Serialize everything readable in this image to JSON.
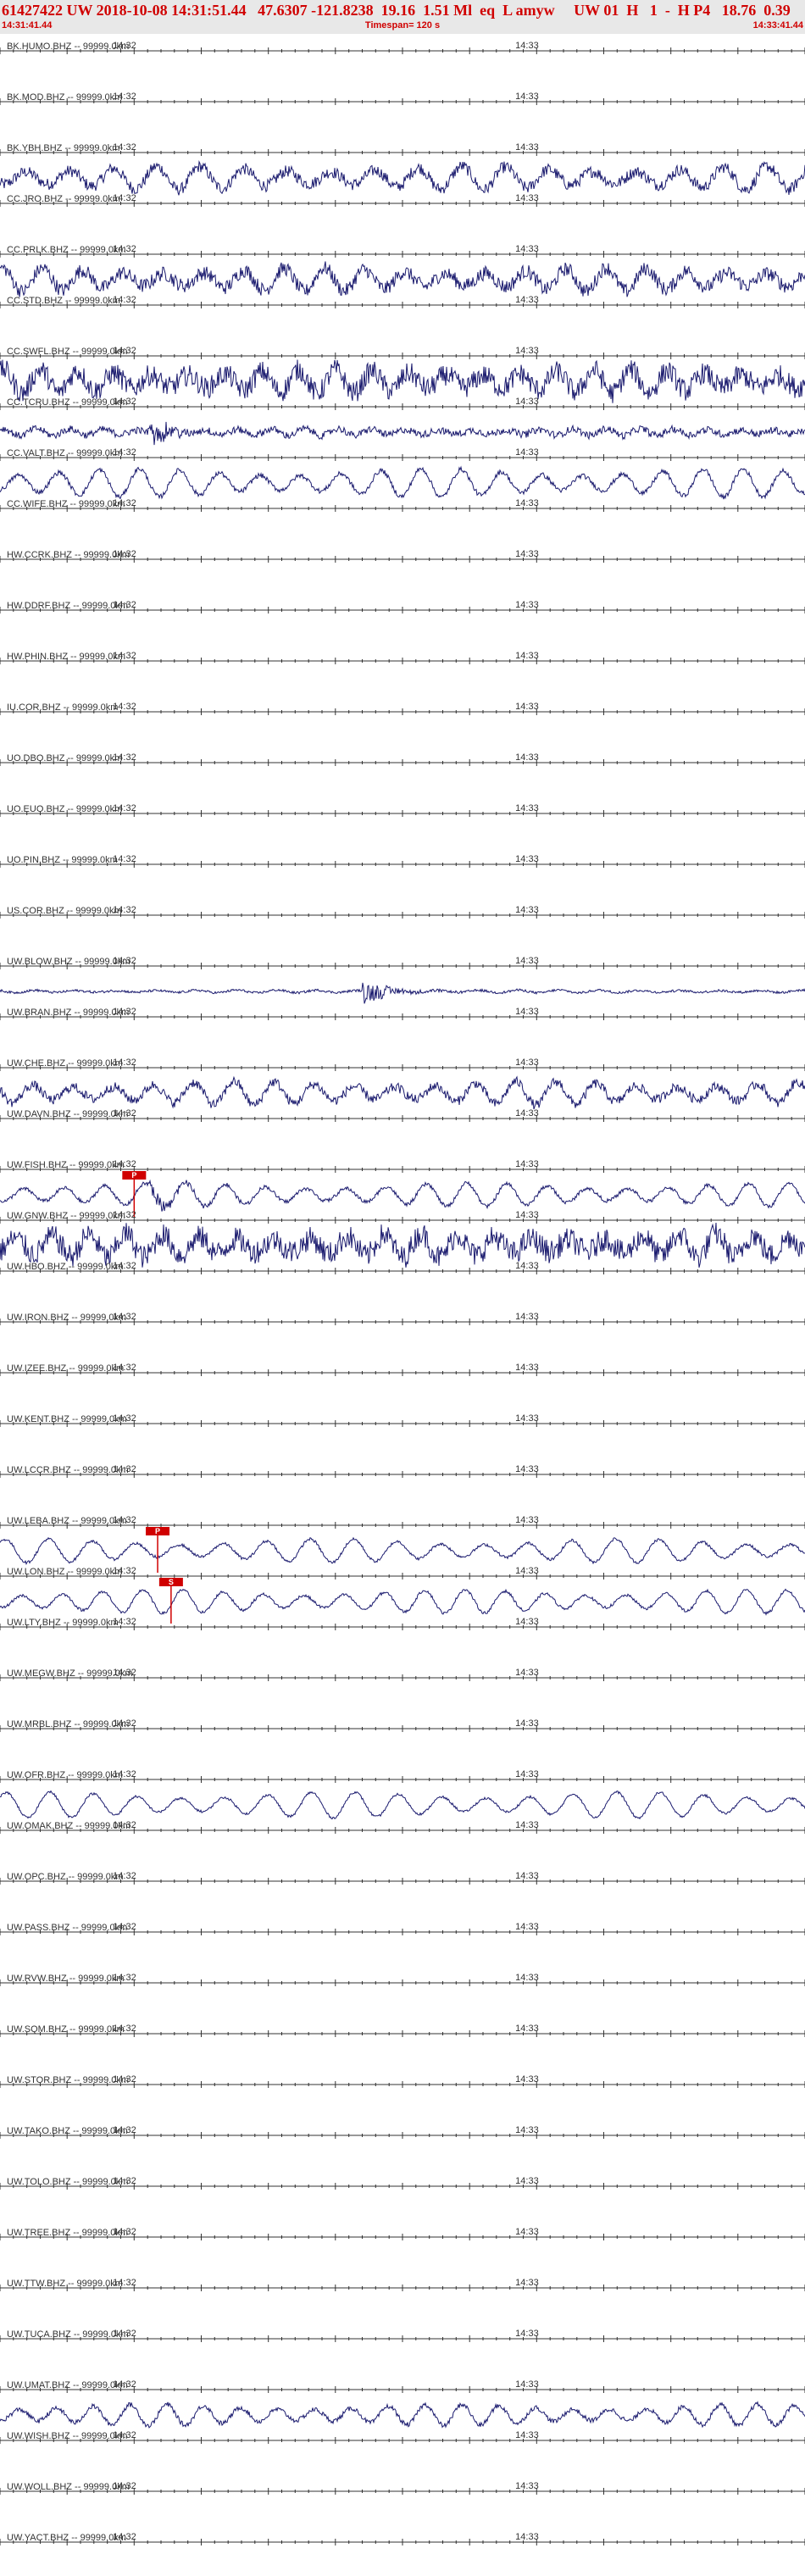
{
  "header": {
    "title": "61427422 UW 2018-10-08 14:31:51.44   47.6307 -121.8238  19.16  1.51 Ml  eq  L amyw     UW 01  H   1  -  H P4   18.76  0.39",
    "start_time": "14:31:41.44",
    "timespan": "Timespan= 120 s",
    "end_time": "14:33:41.44"
  },
  "colors": {
    "trace": "#1a1a6e",
    "axis": "#333333",
    "pick": "#d00000",
    "header_bg": "#e8e8e8"
  },
  "chart_data": {
    "type": "line",
    "title": "61427422 UW 2018-10-08 14:31:51.44",
    "x_unit": "seconds",
    "xlim": [
      0,
      120
    ],
    "time_ticks": [
      {
        "label": "14:32",
        "t": 18.56
      },
      {
        "label": "14:33",
        "t": 78.56
      }
    ],
    "stations": [
      {
        "name": "BK.HUMO.BHZ -- 99999.0km",
        "amplitude": 0,
        "period": 0,
        "noise": 0
      },
      {
        "name": "BK.MOD.BHZ -- 99999.0km",
        "amplitude": 0,
        "period": 0,
        "noise": 0
      },
      {
        "name": "BK.YBH.BHZ -- 99999.0km",
        "amplitude": 0.5,
        "period": 6.5,
        "noise": 0.25
      },
      {
        "name": "CC.JRO.BHZ -- 99999.0km",
        "amplitude": 0,
        "period": 0,
        "noise": 0
      },
      {
        "name": "CC.PRLK.BHZ -- 99999.0km",
        "amplitude": 0.5,
        "period": 6,
        "noise": 0.3
      },
      {
        "name": "CC.STD.BHZ -- 99999.0km",
        "amplitude": 0,
        "period": 0,
        "noise": 0
      },
      {
        "name": "CC.SWFL.BHZ -- 99999.0km",
        "amplitude": 0.5,
        "period": 5.5,
        "noise": 0.45
      },
      {
        "name": "CC.TCRU.BHZ -- 99999.0km",
        "amplitude": 0.15,
        "period": 5,
        "noise": 0.15,
        "event_t": 22,
        "event_amp": 0.55
      },
      {
        "name": "CC.VALT.BHZ -- 99999.0km",
        "amplitude": 0.6,
        "period": 6,
        "noise": 0.1
      },
      {
        "name": "CC.WIFE.BHZ -- 99999.0km",
        "amplitude": 0,
        "period": 0,
        "noise": 0
      },
      {
        "name": "HW.CCRK.BHZ -- 99999.0km",
        "amplitude": 0,
        "period": 0,
        "noise": 0
      },
      {
        "name": "HW.DDRF.BHZ -- 99999.0km",
        "amplitude": 0,
        "period": 0,
        "noise": 0
      },
      {
        "name": "HW.PHIN.BHZ -- 99999.0km",
        "amplitude": 0,
        "period": 0,
        "noise": 0
      },
      {
        "name": "IU.COR.BHZ -- 99999.0km",
        "amplitude": 0,
        "period": 0,
        "noise": 0
      },
      {
        "name": "UO.DBO.BHZ -- 99999.0km",
        "amplitude": 0,
        "period": 0,
        "noise": 0
      },
      {
        "name": "UO.EUO.BHZ -- 99999.0km",
        "amplitude": 0,
        "period": 0,
        "noise": 0
      },
      {
        "name": "UO.PIN.BHZ -- 99999.0km",
        "amplitude": 0,
        "period": 0,
        "noise": 0
      },
      {
        "name": "US.COR.BHZ -- 99999.0km",
        "amplitude": 0,
        "period": 0,
        "noise": 0
      },
      {
        "name": "UW.BLOW.BHZ -- 99999.0km",
        "amplitude": 0.06,
        "period": 6,
        "noise": 0.05,
        "event_t": 54,
        "event_amp": 0.55
      },
      {
        "name": "UW.BRAN.BHZ -- 99999.0km",
        "amplitude": 0,
        "period": 0,
        "noise": 0
      },
      {
        "name": "UW.CHE.BHZ -- 99999.0km",
        "amplitude": 0.5,
        "period": 6,
        "noise": 0.2
      },
      {
        "name": "UW.DAVN.BHZ -- 99999.0km",
        "amplitude": 0,
        "period": 0,
        "noise": 0
      },
      {
        "name": "UW.FISH.BHZ -- 99999.0km",
        "amplitude": 0.5,
        "period": 6,
        "noise": 0.08,
        "event_t": 22,
        "event_amp": 0.4,
        "pick_t": 20,
        "pick_label": "P"
      },
      {
        "name": "UW.GNW.BHZ -- 99999.0km",
        "amplitude": 0.5,
        "period": 5.5,
        "noise": 0.5
      },
      {
        "name": "UW.HBO.BHZ -- 99999.0km",
        "amplitude": 0,
        "period": 0,
        "noise": 0
      },
      {
        "name": "UW.IRON.BHZ -- 99999.0km",
        "amplitude": 0,
        "period": 0,
        "noise": 0
      },
      {
        "name": "UW.IZEE.BHZ -- 99999.0km",
        "amplitude": 0,
        "period": 0,
        "noise": 0
      },
      {
        "name": "UW.KENT.BHZ -- 99999.0km",
        "amplitude": 0,
        "period": 0,
        "noise": 0
      },
      {
        "name": "UW.LCCR.BHZ -- 99999.0km",
        "amplitude": 0,
        "period": 0,
        "noise": 0
      },
      {
        "name": "UW.LEBA.BHZ -- 99999.0km",
        "amplitude": 0.5,
        "period": 6.5,
        "noise": 0.06,
        "pick_t": 23.5,
        "pick_label": "P"
      },
      {
        "name": "UW.LON.BHZ -- 99999.0km",
        "amplitude": 0.5,
        "period": 6,
        "noise": 0.06,
        "pick_t": 25.5,
        "pick_label": "S"
      },
      {
        "name": "UW.LTY.BHZ -- 99999.0km",
        "amplitude": 0,
        "period": 0,
        "noise": 0
      },
      {
        "name": "UW.MEGW.BHZ -- 99999.0km",
        "amplitude": 0,
        "period": 0,
        "noise": 0
      },
      {
        "name": "UW.MRBL.BHZ -- 99999.0km",
        "amplitude": 0,
        "period": 0,
        "noise": 0
      },
      {
        "name": "UW.OFR.BHZ -- 99999.0km",
        "amplitude": 0.55,
        "period": 6.5,
        "noise": 0.05
      },
      {
        "name": "UW.OMAK.BHZ -- 99999.0km",
        "amplitude": 0,
        "period": 0,
        "noise": 0
      },
      {
        "name": "UW.OPC.BHZ -- 99999.0km",
        "amplitude": 0,
        "period": 0,
        "noise": 0
      },
      {
        "name": "UW.PASS.BHZ -- 99999.0km",
        "amplitude": 0,
        "period": 0,
        "noise": 0
      },
      {
        "name": "UW.RVW.BHZ -- 99999.0km",
        "amplitude": 0,
        "period": 0,
        "noise": 0
      },
      {
        "name": "UW.SQM.BHZ -- 99999.0km",
        "amplitude": 0,
        "period": 0,
        "noise": 0
      },
      {
        "name": "UW.STOR.BHZ -- 99999.0km",
        "amplitude": 0,
        "period": 0,
        "noise": 0
      },
      {
        "name": "UW.TAKO.BHZ -- 99999.0km",
        "amplitude": 0,
        "period": 0,
        "noise": 0
      },
      {
        "name": "UW.TOLO.BHZ -- 99999.0km",
        "amplitude": 0,
        "period": 0,
        "noise": 0
      },
      {
        "name": "UW.TREE.BHZ -- 99999.0km",
        "amplitude": 0,
        "period": 0,
        "noise": 0
      },
      {
        "name": "UW.TTW.BHZ -- 99999.0km",
        "amplitude": 0,
        "period": 0,
        "noise": 0
      },
      {
        "name": "UW.TUCA.BHZ -- 99999.0km",
        "amplitude": 0,
        "period": 0,
        "noise": 0
      },
      {
        "name": "UW.UMAT.BHZ -- 99999.0km",
        "amplitude": 0.45,
        "period": 5.5,
        "noise": 0.1
      },
      {
        "name": "UW.WISH.BHZ -- 99999.0km",
        "amplitude": 0,
        "period": 0,
        "noise": 0
      },
      {
        "name": "UW.WOLL.BHZ -- 99999.0km",
        "amplitude": 0,
        "period": 0,
        "noise": 0
      },
      {
        "name": "UW.YACT.BHZ -- 99999.0km",
        "amplitude": 0,
        "period": 0,
        "noise": 0
      }
    ]
  }
}
